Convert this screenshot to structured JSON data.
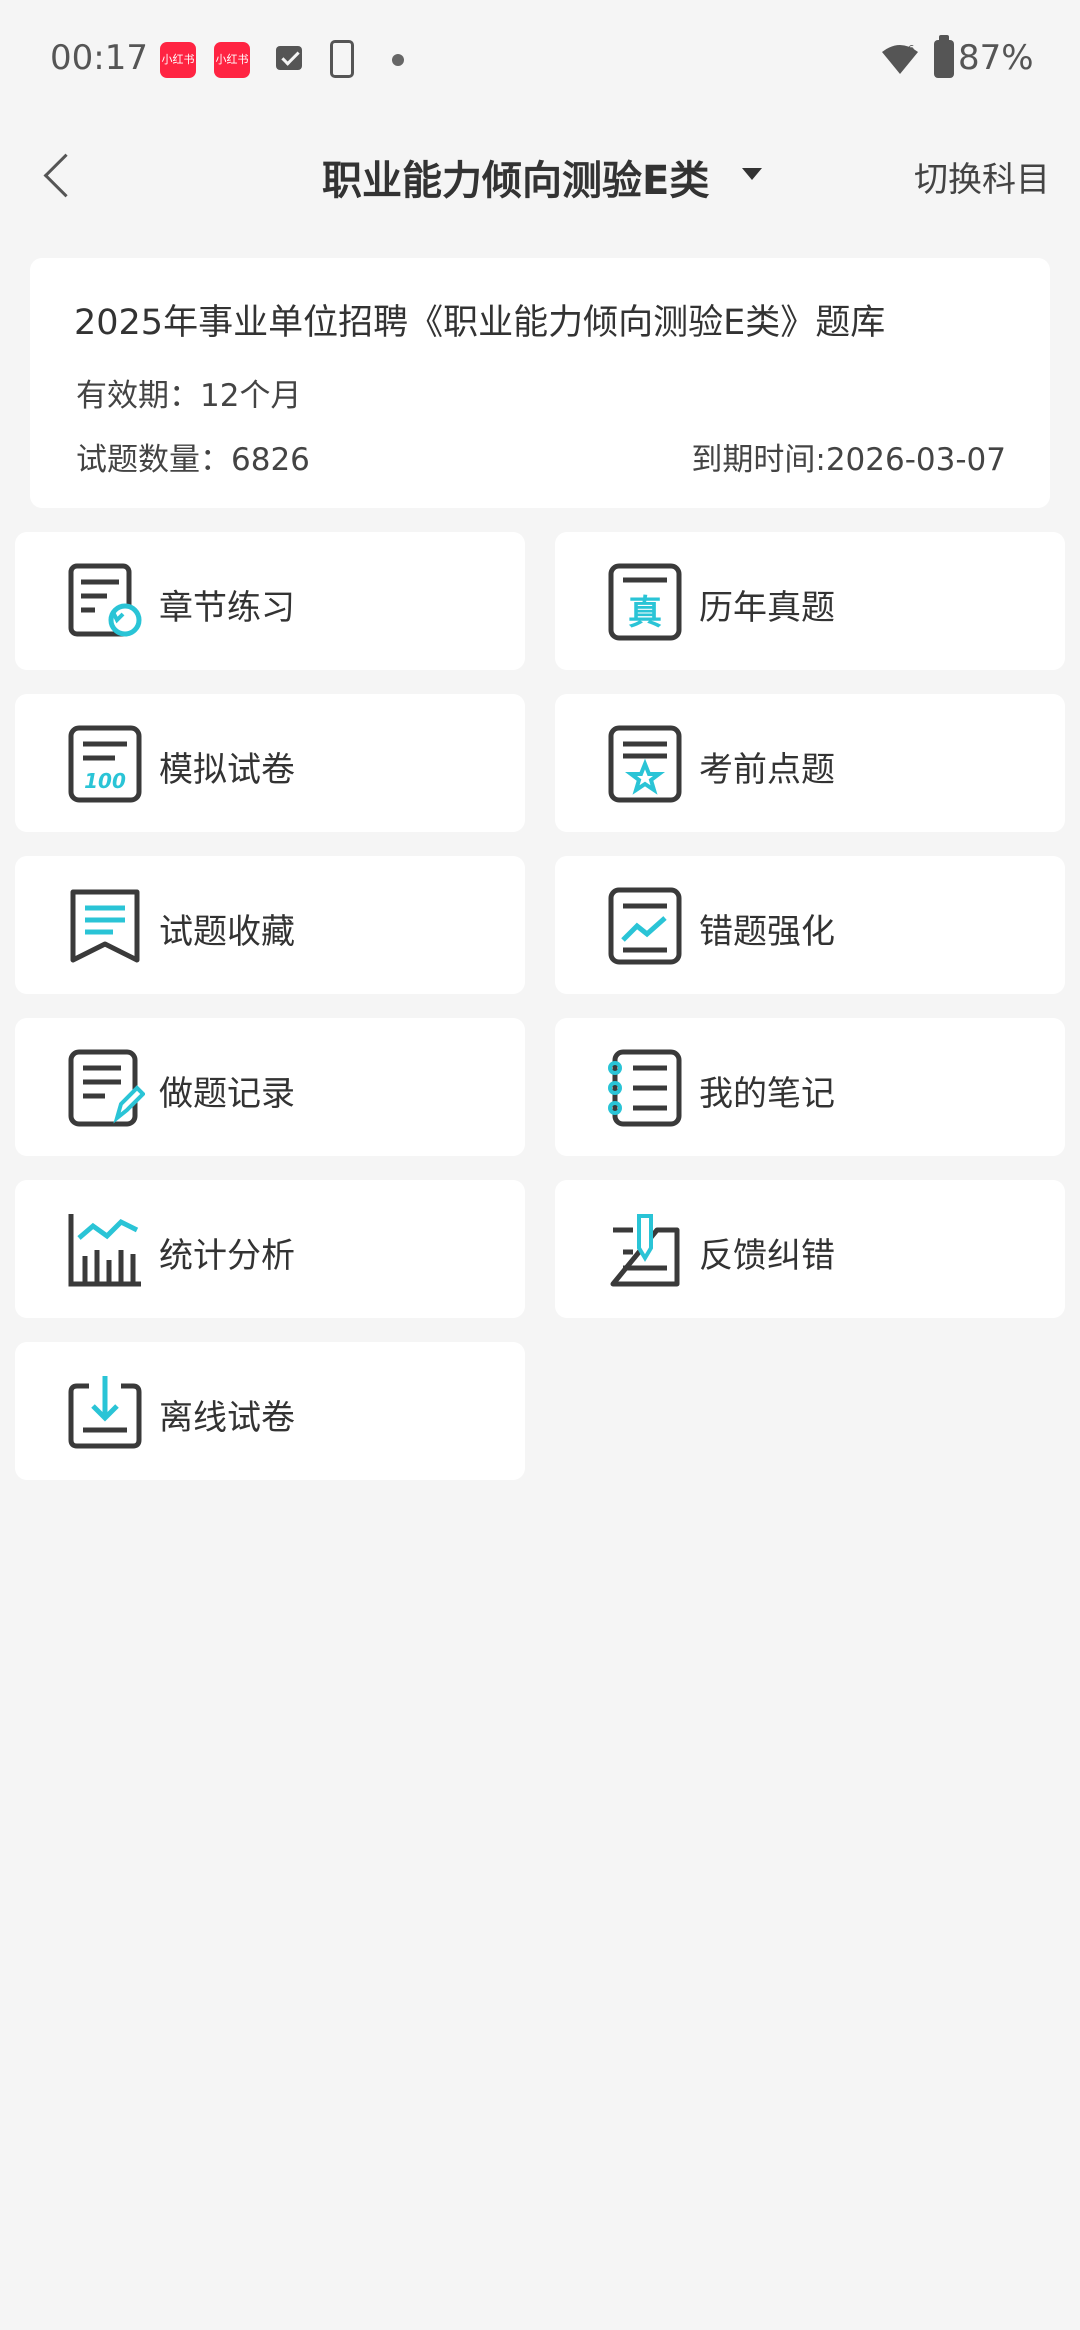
{
  "status_bar": {
    "time": "00:17",
    "app_icon_1": "小红书",
    "app_icon_2": "小红书",
    "battery": "87%"
  },
  "header": {
    "title": "职业能力倾向测验E类",
    "switch_label": "切换科目"
  },
  "info": {
    "title": "2025年事业单位招聘《职业能力倾向测验E类》题库",
    "validity": "有效期：12个月",
    "question_count": "试题数量：6826",
    "expire": "到期时间:2026-03-07"
  },
  "menu": [
    {
      "label": "章节练习",
      "icon": "chapter-practice-icon"
    },
    {
      "label": "历年真题",
      "icon": "past-exam-icon"
    },
    {
      "label": "模拟试卷",
      "icon": "mock-paper-icon"
    },
    {
      "label": "考前点题",
      "icon": "pre-exam-tips-icon"
    },
    {
      "label": "试题收藏",
      "icon": "bookmark-icon"
    },
    {
      "label": "错题强化",
      "icon": "wrong-question-icon"
    },
    {
      "label": "做题记录",
      "icon": "record-icon"
    },
    {
      "label": "我的笔记",
      "icon": "notebook-icon"
    },
    {
      "label": "统计分析",
      "icon": "stats-icon"
    },
    {
      "label": "反馈纠错",
      "icon": "feedback-icon"
    },
    {
      "label": "离线试卷",
      "icon": "download-icon"
    }
  ],
  "colors": {
    "accent": "#2ac4d6",
    "icon_dark": "#3a3a3a",
    "background": "#f5f5f5",
    "card": "#ffffff"
  }
}
